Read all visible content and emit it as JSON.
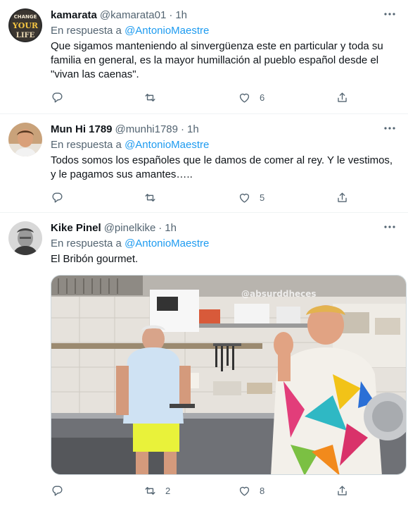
{
  "tweets": [
    {
      "name": "kamarata",
      "handle": "@kamarata01",
      "dot": "·",
      "time": "1h",
      "reply_prefix": "En respuesta a",
      "reply_to": "@AntonioMaestre",
      "text": "Que sigamos manteniendo al sinvergüenza este en particular y toda su familia en general, es la mayor humillación al pueblo español desde el \"vivan las caenas\".",
      "avatar_text": [
        "CHANGE",
        "YOUR",
        "LIFE"
      ],
      "replies": "",
      "retweets": "",
      "likes": "6"
    },
    {
      "name": "Mun Hi 1789",
      "handle": "@munhi1789",
      "dot": "·",
      "time": "1h",
      "reply_prefix": "En respuesta a",
      "reply_to": "@AntonioMaestre",
      "text": "Todos somos los españoles que le damos de comer al rey. Y le vestimos, y le pagamos sus amantes…..",
      "replies": "",
      "retweets": "",
      "likes": "5"
    },
    {
      "name": "Kike Pinel",
      "handle": "@pinelkike",
      "dot": "·",
      "time": "1h",
      "reply_prefix": "En respuesta a",
      "reply_to": "@AntonioMaestre",
      "text": "El Bribón gourmet.",
      "media_watermark": "@absurddheces",
      "replies": "",
      "retweets": "2",
      "likes": "8"
    }
  ],
  "colors": {
    "accent": "#1d9bf0",
    "secondary_text": "#536471",
    "primary_text": "#0f1419",
    "divider": "#eff3f4"
  },
  "icons": {
    "more": "more-horizontal-icon",
    "reply": "reply-bubble-icon",
    "retweet": "retweet-icon",
    "like": "heart-icon",
    "share": "share-icon"
  }
}
